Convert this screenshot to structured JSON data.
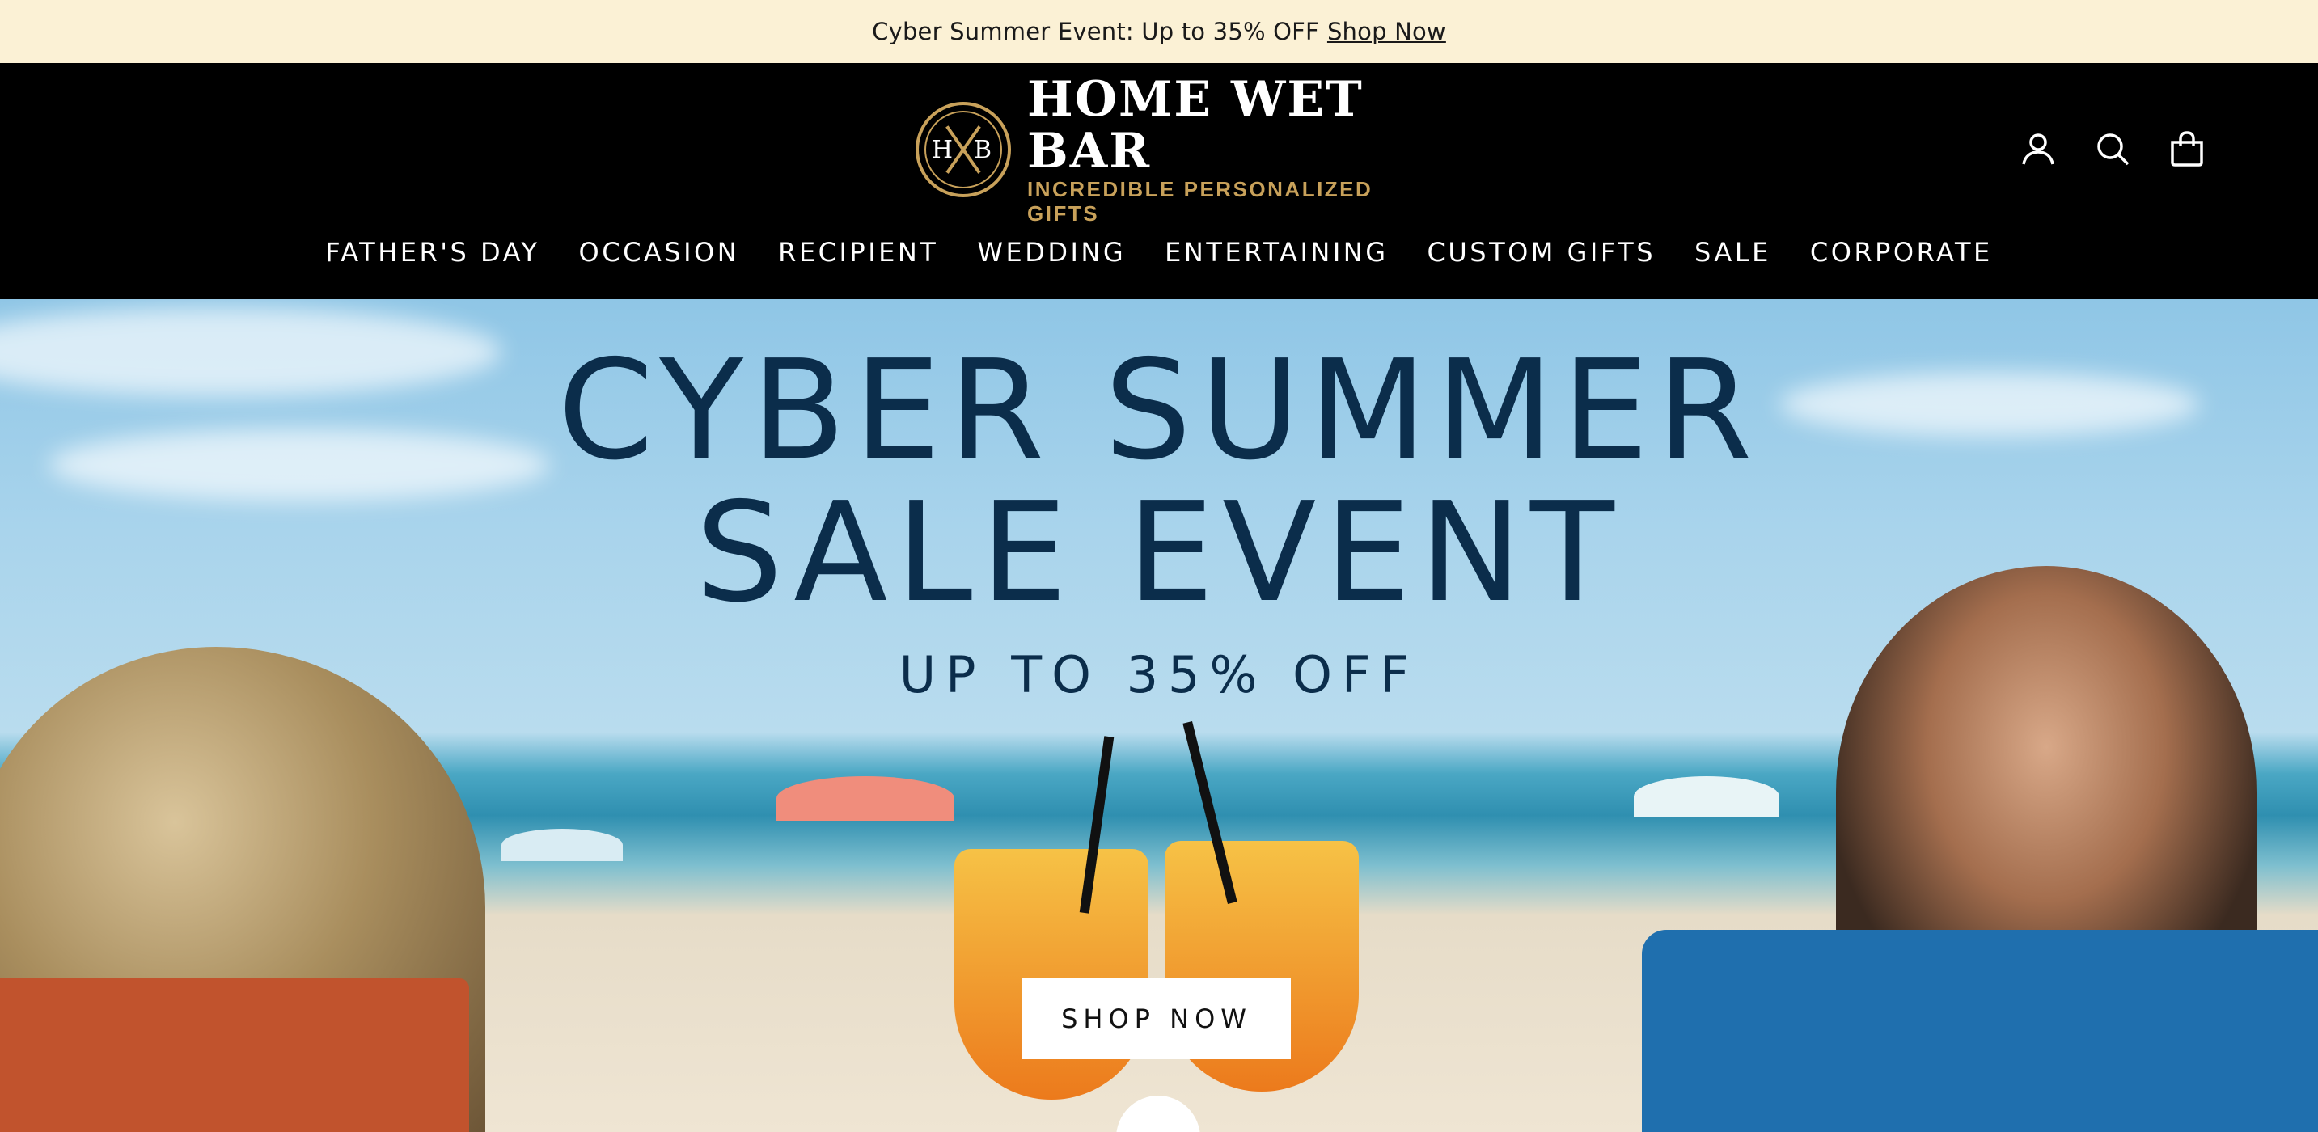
{
  "announcement": {
    "text": "Cyber Summer Event: Up to 35% OFF",
    "link_label": "Shop Now"
  },
  "logo": {
    "monogram": "HB",
    "title": "HOME WET BAR",
    "tagline": "INCREDIBLE PERSONALIZED GIFTS"
  },
  "header_icons": [
    "account-icon",
    "search-icon",
    "cart-bag-icon"
  ],
  "nav": {
    "items": [
      "FATHER'S DAY",
      "OCCASION",
      "RECIPIENT",
      "WEDDING",
      "ENTERTAINING",
      "CUSTOM GIFTS",
      "SALE",
      "CORPORATE"
    ]
  },
  "hero": {
    "title_line1": "CYBER SUMMER",
    "title_line2": "SALE EVENT",
    "subtitle": "UP TO 35% OFF",
    "cta_label": "SHOP NOW"
  },
  "colors": {
    "announcement_bg": "#fbf1d5",
    "header_bg": "#000000",
    "logo_gold": "#c8a15a",
    "hero_title": "#0b2d4b"
  }
}
